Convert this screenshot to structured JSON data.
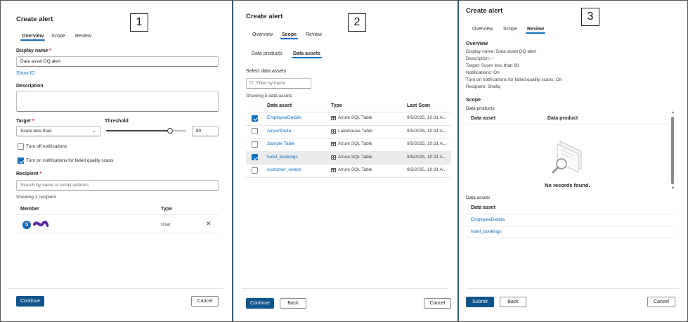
{
  "panel1": {
    "title": "Create alert",
    "step_number": "1",
    "tabs": [
      {
        "label": "Overview",
        "active": true
      },
      {
        "label": "Scope",
        "active": false
      },
      {
        "label": "Review",
        "active": false
      }
    ],
    "display_name_label": "Display name",
    "required_mark": "*",
    "display_name_value": "Data asset DQ alert",
    "show_id_link": "Show ID",
    "description_label": "Description",
    "description_value": "",
    "target_label": "Target",
    "target_value": "Score less than",
    "threshold_label": "Threshold",
    "threshold_value": "80",
    "threshold_slider_fraction": 0.8,
    "turn_off_notifications_label": "Turn off notifications",
    "turn_off_notifications_checked": false,
    "failed_scans_label": "Turn on notifications for failed quality scans",
    "failed_scans_checked": true,
    "recipient_label": "Recipient",
    "recipient_placeholder": "Search by name or email address",
    "showing_text": "Showing 1 recipient",
    "table_headers": {
      "member": "Member",
      "type": "Type"
    },
    "recipients": [
      {
        "initial": "S",
        "type": "User"
      }
    ],
    "remove_icon": "close-icon",
    "continue_label": "Continue",
    "cancel_label": "Cancel"
  },
  "panel2": {
    "title": "Create alert",
    "step_number": "2",
    "tabs": [
      {
        "label": "Overview",
        "active": false
      },
      {
        "label": "Scope",
        "active": true
      },
      {
        "label": "Review",
        "active": false
      }
    ],
    "subtabs": [
      {
        "label": "Data products",
        "active": false
      },
      {
        "label": "Data assets",
        "active": true
      }
    ],
    "select_label": "Select data assets",
    "filter_placeholder": "Filter by name",
    "showing_text": "Showing 5 data assets",
    "table_headers": {
      "asset": "Data asset",
      "type": "Type",
      "last_scan": "Last Scan"
    },
    "rows": [
      {
        "name": "EmployeeDetails",
        "type": "Azure SQL Table",
        "icon": "table-icon",
        "last_scan": "9/5/2025, 10:31 A...",
        "checked": true,
        "highlighted": false
      },
      {
        "name": "AirportDelta",
        "type": "Lakehouse Table",
        "icon": "lakehouse-table-icon",
        "last_scan": "9/5/2025, 10:31 A...",
        "checked": false,
        "highlighted": false
      },
      {
        "name": "Sample Table",
        "type": "Azure SQL Table",
        "icon": "table-icon",
        "last_scan": "9/5/2025, 10:31 A...",
        "checked": false,
        "highlighted": false
      },
      {
        "name": "hotel_bookings",
        "type": "Azure SQL Table",
        "icon": "table-icon",
        "last_scan": "9/5/2025, 10:31 A...",
        "checked": true,
        "highlighted": true
      },
      {
        "name": "customer_orders",
        "type": "Azure SQL Table",
        "icon": "table-icon",
        "last_scan": "9/5/2025, 10:31 A...",
        "checked": false,
        "highlighted": false
      }
    ],
    "continue_label": "Continue",
    "back_label": "Back",
    "cancel_label": "Cancel"
  },
  "panel3": {
    "title": "Create alert",
    "step_number": "3",
    "tabs": [
      {
        "label": "Overview",
        "active": false
      },
      {
        "label": "Scope",
        "active": false
      },
      {
        "label": "Review",
        "active": true
      }
    ],
    "overview_heading": "Overview",
    "overview_lines": [
      "Display name: Data asset DQ alert",
      "Description: -",
      "Target: Score less than 80",
      "Notifications: On",
      "Turn on notifications for failed quality scans: On",
      "Recipient: Shafiq"
    ],
    "scope_heading": "Scope",
    "data_products_label": "Data products",
    "products_headers": {
      "asset": "Data asset",
      "product": "Data product"
    },
    "empty_text": "No records found.",
    "data_assets_label": "Data assets",
    "assets_header": "Data asset",
    "assets": [
      "EmployeeDetails",
      "hotel_bookings"
    ],
    "submit_label": "Submit",
    "back_label": "Back",
    "cancel_label": "Cancel"
  },
  "colors": {
    "accent": "#0f6cbd",
    "primary_button": "#0f548c",
    "separator": "#2f5a7a",
    "recipient_mark": "#5b2a9e"
  }
}
